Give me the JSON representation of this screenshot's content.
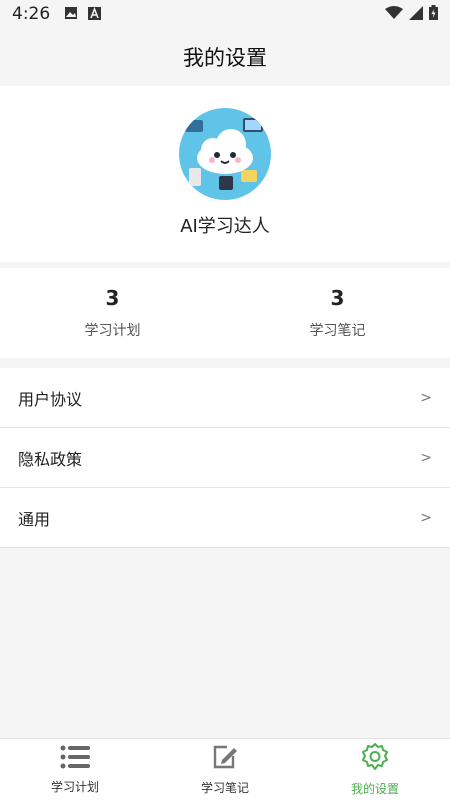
{
  "status_bar": {
    "time": "4:26",
    "icons": [
      "image-icon",
      "a-badge-icon",
      "wifi-icon",
      "signal-icon",
      "battery-icon"
    ]
  },
  "header": {
    "title": "我的设置"
  },
  "profile": {
    "username": "AI学习达人"
  },
  "stats": [
    {
      "value": "3",
      "label": "学习计划"
    },
    {
      "value": "3",
      "label": "学习笔记"
    }
  ],
  "menu": [
    {
      "label": "用户协议",
      "chevron": ">"
    },
    {
      "label": "隐私政策",
      "chevron": ">"
    },
    {
      "label": "通用",
      "chevron": ">"
    }
  ],
  "tabs": [
    {
      "label": "学习计划",
      "icon": "list-icon",
      "active": false
    },
    {
      "label": "学习笔记",
      "icon": "edit-note-icon",
      "active": false
    },
    {
      "label": "我的设置",
      "icon": "gear-icon",
      "active": true
    }
  ],
  "colors": {
    "accent": "#4caf50",
    "background": "#f5f5f5"
  }
}
